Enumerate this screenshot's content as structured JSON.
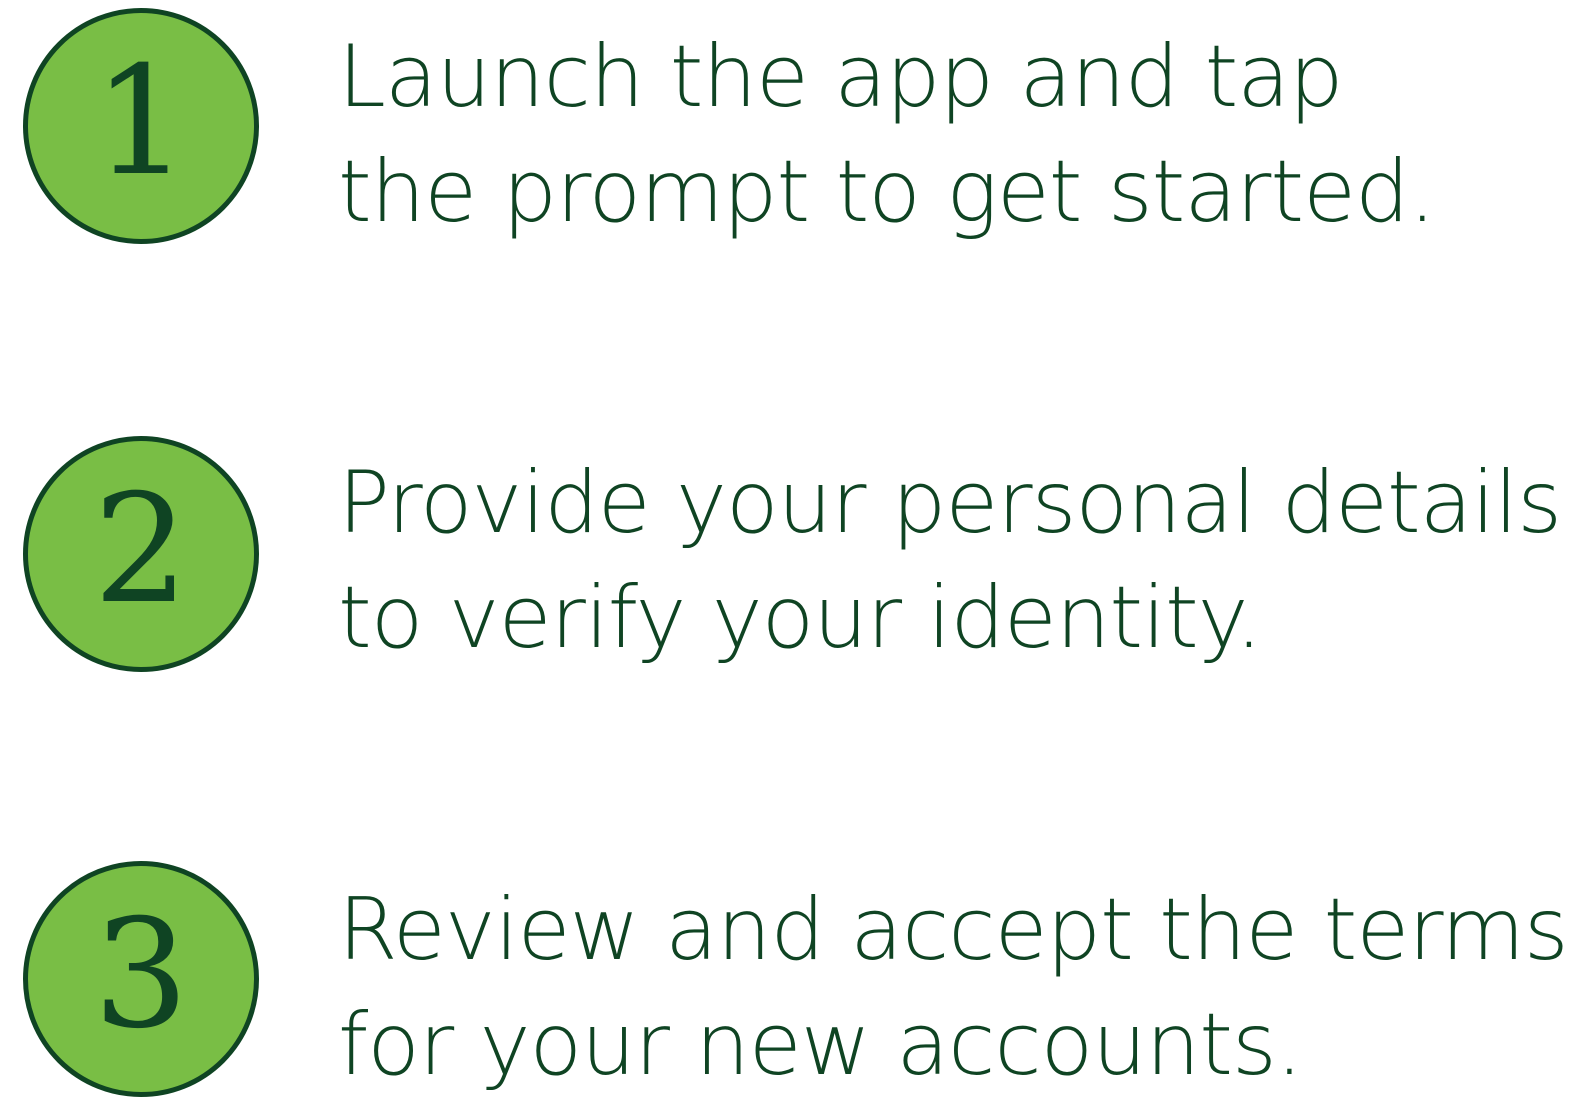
{
  "colors": {
    "badge_fill": "#79be45",
    "ink": "#0f4423",
    "background": "#ffffff"
  },
  "steps": [
    {
      "number": "1",
      "lines": [
        "Launch the app and tap",
        "the prompt to get started."
      ]
    },
    {
      "number": "2",
      "lines": [
        "Provide your personal details",
        "to verify your identity."
      ]
    },
    {
      "number": "3",
      "lines": [
        "Review and accept the terms",
        "for your new accounts."
      ]
    }
  ]
}
